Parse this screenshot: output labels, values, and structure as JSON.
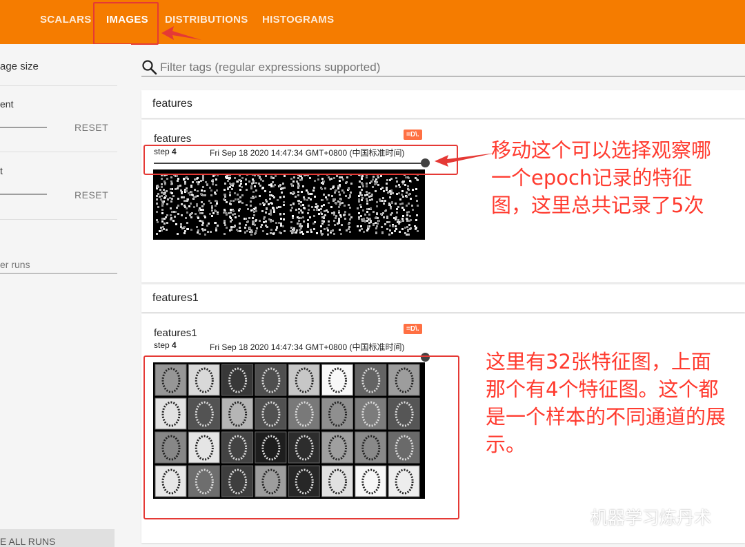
{
  "tabs": [
    {
      "label": "SCALARS"
    },
    {
      "label": "IMAGES"
    },
    {
      "label": "DISTRIBUTIONS"
    },
    {
      "label": "HISTOGRAMS"
    }
  ],
  "sidebar": {
    "image_size_label": "age size",
    "brightness_label": "ent",
    "contrast_label": "t",
    "reset_label": "RESET",
    "runs_filter_placeholder": "er runs",
    "toggle_runs_label": "E ALL RUNS"
  },
  "filter": {
    "placeholder": "Filter tags (regular expressions supported)"
  },
  "sections": [
    {
      "header": "features",
      "card": {
        "title": "features",
        "step_label": "step",
        "step_value": "4",
        "timestamp": "Fri Sep 18 2020 14:47:34 GMT+0800 (中国标准时间)",
        "run": "=D\\.",
        "slider_fraction": 1.0
      }
    },
    {
      "header": "features1",
      "card": {
        "title": "features1",
        "step_label": "step",
        "step_value": "4",
        "timestamp": "Fri Sep 18 2020 14:47:34 GMT+0800 (中国标准时间)",
        "run": "=D\\.",
        "slider_fraction": 1.0
      }
    }
  ],
  "annotations": {
    "slider_note": [
      "移动这个可以选择观察哪",
      "一个epoch记录的特征",
      "图，这里总共记录了5次"
    ],
    "grid_note": [
      "这里有32张特征图，上面",
      "那个有4个特征图。这个都",
      "是一个样本的不同通道的展",
      "示。"
    ]
  },
  "watermark": "机器学习炼丹术",
  "colors": {
    "topbar": "#f57c00",
    "annotation": "#ff3b2f",
    "badge": "#ff7043"
  }
}
